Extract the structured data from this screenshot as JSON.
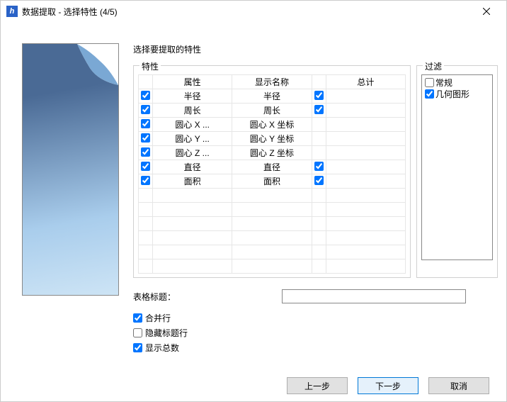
{
  "title": "数据提取 - 选择特性 (4/5)",
  "instruction": "选择要提取的特性",
  "groups": {
    "attributes": "特性",
    "filter": "过滤"
  },
  "columns": {
    "attr": "属性",
    "display": "显示名称",
    "total": "总计"
  },
  "rows": [
    {
      "checked": true,
      "attr": "半径",
      "display": "半径",
      "totalShow": true,
      "totalChecked": true
    },
    {
      "checked": true,
      "attr": "周长",
      "display": "周长",
      "totalShow": true,
      "totalChecked": true
    },
    {
      "checked": true,
      "attr": "圆心 X ...",
      "display": "圆心 X 坐标",
      "totalShow": false,
      "totalChecked": false
    },
    {
      "checked": true,
      "attr": "圆心 Y ...",
      "display": "圆心 Y 坐标",
      "totalShow": false,
      "totalChecked": false
    },
    {
      "checked": true,
      "attr": "圆心 Z ...",
      "display": "圆心 Z 坐标",
      "totalShow": false,
      "totalChecked": false
    },
    {
      "checked": true,
      "attr": "直径",
      "display": "直径",
      "totalShow": true,
      "totalChecked": true
    },
    {
      "checked": true,
      "attr": "面积",
      "display": "面积",
      "totalShow": true,
      "totalChecked": true
    }
  ],
  "filters": [
    {
      "checked": false,
      "label": "常规"
    },
    {
      "checked": true,
      "label": "几何图形"
    }
  ],
  "tableTitleLabel": "表格标题：",
  "tableTitleValue": "",
  "options": [
    {
      "checked": true,
      "label": "合并行"
    },
    {
      "checked": false,
      "label": "隐藏标题行"
    },
    {
      "checked": true,
      "label": "显示总数"
    }
  ],
  "buttons": {
    "prev": "上一步",
    "next": "下一步",
    "cancel": "取消"
  }
}
